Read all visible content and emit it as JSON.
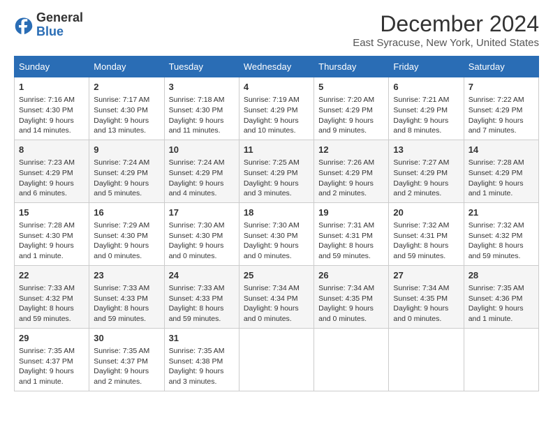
{
  "logo": {
    "general": "General",
    "blue": "Blue"
  },
  "title": "December 2024",
  "subtitle": "East Syracuse, New York, United States",
  "weekdays": [
    "Sunday",
    "Monday",
    "Tuesday",
    "Wednesday",
    "Thursday",
    "Friday",
    "Saturday"
  ],
  "weeks": [
    [
      {
        "day": "1",
        "info": "Sunrise: 7:16 AM\nSunset: 4:30 PM\nDaylight: 9 hours and 14 minutes."
      },
      {
        "day": "2",
        "info": "Sunrise: 7:17 AM\nSunset: 4:30 PM\nDaylight: 9 hours and 13 minutes."
      },
      {
        "day": "3",
        "info": "Sunrise: 7:18 AM\nSunset: 4:30 PM\nDaylight: 9 hours and 11 minutes."
      },
      {
        "day": "4",
        "info": "Sunrise: 7:19 AM\nSunset: 4:29 PM\nDaylight: 9 hours and 10 minutes."
      },
      {
        "day": "5",
        "info": "Sunrise: 7:20 AM\nSunset: 4:29 PM\nDaylight: 9 hours and 9 minutes."
      },
      {
        "day": "6",
        "info": "Sunrise: 7:21 AM\nSunset: 4:29 PM\nDaylight: 9 hours and 8 minutes."
      },
      {
        "day": "7",
        "info": "Sunrise: 7:22 AM\nSunset: 4:29 PM\nDaylight: 9 hours and 7 minutes."
      }
    ],
    [
      {
        "day": "8",
        "info": "Sunrise: 7:23 AM\nSunset: 4:29 PM\nDaylight: 9 hours and 6 minutes."
      },
      {
        "day": "9",
        "info": "Sunrise: 7:24 AM\nSunset: 4:29 PM\nDaylight: 9 hours and 5 minutes."
      },
      {
        "day": "10",
        "info": "Sunrise: 7:24 AM\nSunset: 4:29 PM\nDaylight: 9 hours and 4 minutes."
      },
      {
        "day": "11",
        "info": "Sunrise: 7:25 AM\nSunset: 4:29 PM\nDaylight: 9 hours and 3 minutes."
      },
      {
        "day": "12",
        "info": "Sunrise: 7:26 AM\nSunset: 4:29 PM\nDaylight: 9 hours and 2 minutes."
      },
      {
        "day": "13",
        "info": "Sunrise: 7:27 AM\nSunset: 4:29 PM\nDaylight: 9 hours and 2 minutes."
      },
      {
        "day": "14",
        "info": "Sunrise: 7:28 AM\nSunset: 4:29 PM\nDaylight: 9 hours and 1 minute."
      }
    ],
    [
      {
        "day": "15",
        "info": "Sunrise: 7:28 AM\nSunset: 4:30 PM\nDaylight: 9 hours and 1 minute."
      },
      {
        "day": "16",
        "info": "Sunrise: 7:29 AM\nSunset: 4:30 PM\nDaylight: 9 hours and 0 minutes."
      },
      {
        "day": "17",
        "info": "Sunrise: 7:30 AM\nSunset: 4:30 PM\nDaylight: 9 hours and 0 minutes."
      },
      {
        "day": "18",
        "info": "Sunrise: 7:30 AM\nSunset: 4:30 PM\nDaylight: 9 hours and 0 minutes."
      },
      {
        "day": "19",
        "info": "Sunrise: 7:31 AM\nSunset: 4:31 PM\nDaylight: 8 hours and 59 minutes."
      },
      {
        "day": "20",
        "info": "Sunrise: 7:32 AM\nSunset: 4:31 PM\nDaylight: 8 hours and 59 minutes."
      },
      {
        "day": "21",
        "info": "Sunrise: 7:32 AM\nSunset: 4:32 PM\nDaylight: 8 hours and 59 minutes."
      }
    ],
    [
      {
        "day": "22",
        "info": "Sunrise: 7:33 AM\nSunset: 4:32 PM\nDaylight: 8 hours and 59 minutes."
      },
      {
        "day": "23",
        "info": "Sunrise: 7:33 AM\nSunset: 4:33 PM\nDaylight: 8 hours and 59 minutes."
      },
      {
        "day": "24",
        "info": "Sunrise: 7:33 AM\nSunset: 4:33 PM\nDaylight: 8 hours and 59 minutes."
      },
      {
        "day": "25",
        "info": "Sunrise: 7:34 AM\nSunset: 4:34 PM\nDaylight: 9 hours and 0 minutes."
      },
      {
        "day": "26",
        "info": "Sunrise: 7:34 AM\nSunset: 4:35 PM\nDaylight: 9 hours and 0 minutes."
      },
      {
        "day": "27",
        "info": "Sunrise: 7:34 AM\nSunset: 4:35 PM\nDaylight: 9 hours and 0 minutes."
      },
      {
        "day": "28",
        "info": "Sunrise: 7:35 AM\nSunset: 4:36 PM\nDaylight: 9 hours and 1 minute."
      }
    ],
    [
      {
        "day": "29",
        "info": "Sunrise: 7:35 AM\nSunset: 4:37 PM\nDaylight: 9 hours and 1 minute."
      },
      {
        "day": "30",
        "info": "Sunrise: 7:35 AM\nSunset: 4:37 PM\nDaylight: 9 hours and 2 minutes."
      },
      {
        "day": "31",
        "info": "Sunrise: 7:35 AM\nSunset: 4:38 PM\nDaylight: 9 hours and 3 minutes."
      },
      null,
      null,
      null,
      null
    ]
  ]
}
